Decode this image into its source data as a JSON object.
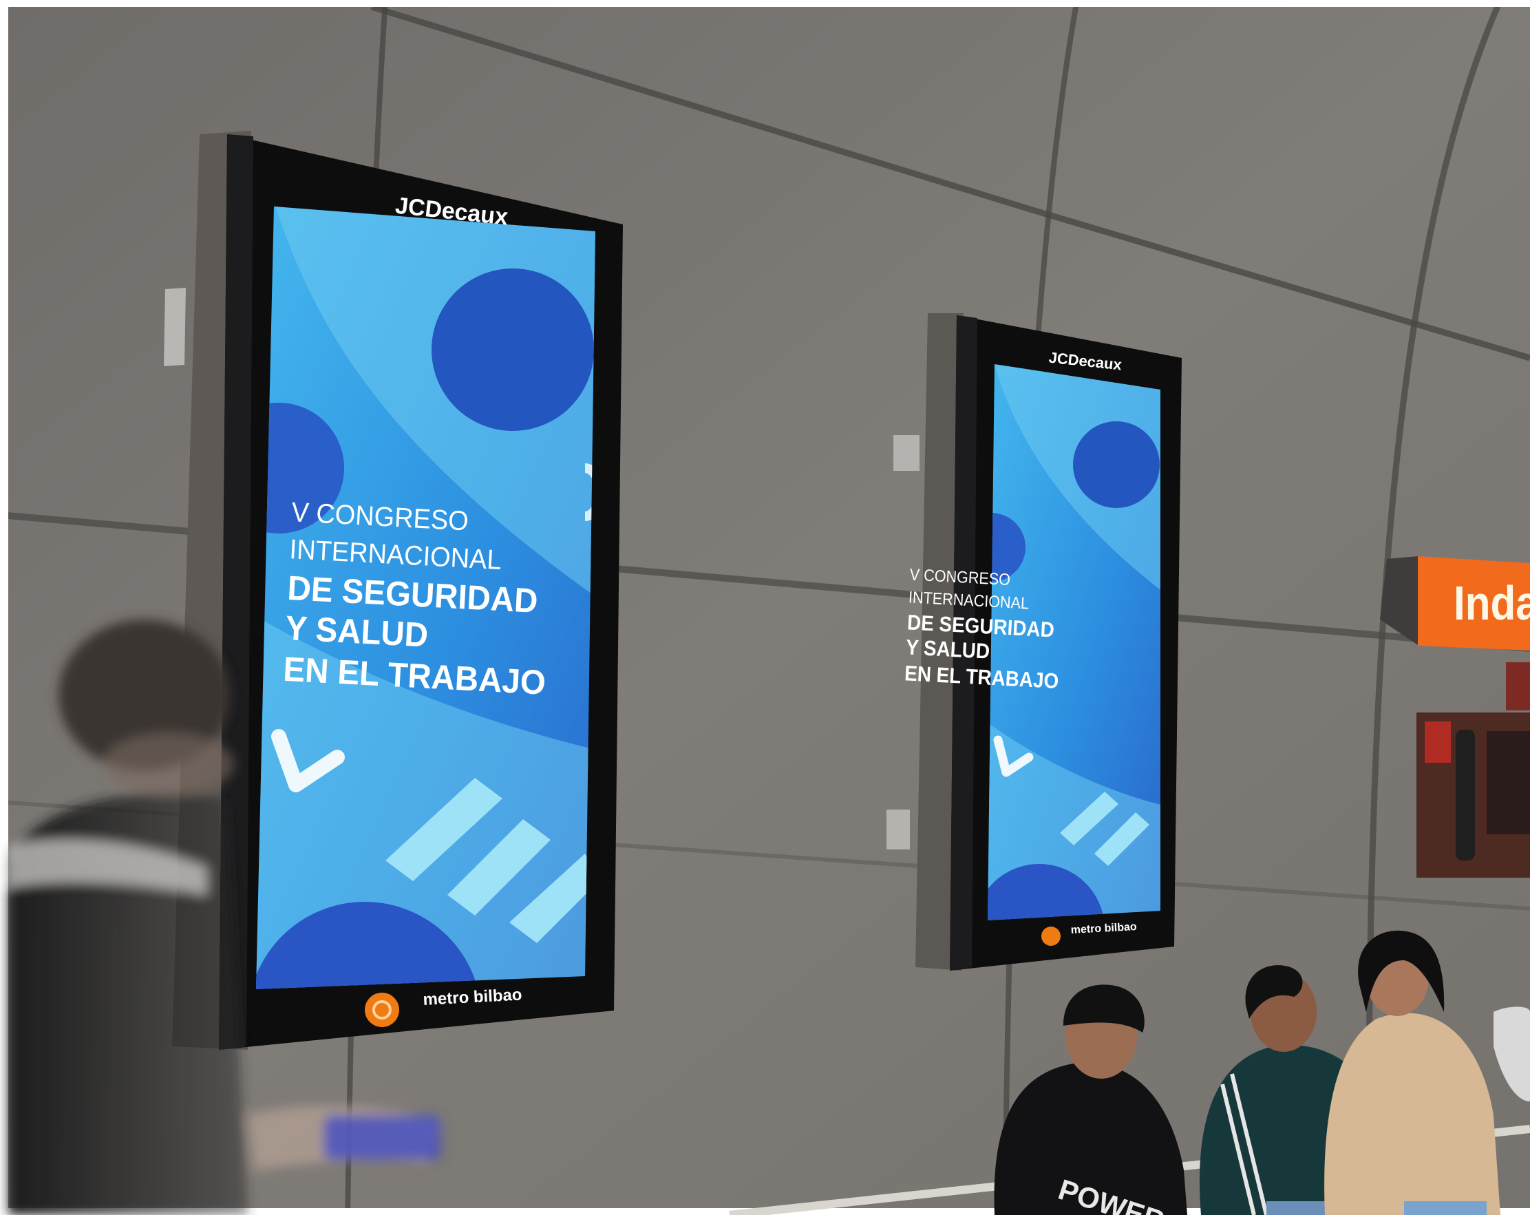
{
  "photo": {
    "description_free": true,
    "station_sign": {
      "text": "Indaut",
      "color": "#f26a1b"
    },
    "sign_boxes": [
      {
        "id": "screen-left",
        "brand": "JCDecaux",
        "headline_lines": [
          "V CONGRESO",
          "INTERNACIONAL",
          "DE SEGURIDAD",
          "Y SALUD",
          "EN EL TRABAJO"
        ],
        "footer": "metro bilbao",
        "colors": {
          "bg": "#2fa6e8",
          "deep": "#244fb8",
          "light": "#7fd4f1"
        }
      },
      {
        "id": "screen-right",
        "brand": "JCDecaux",
        "headline_lines": [
          "V CONGRESO",
          "INTERNACIONAL",
          "DE SEGURIDAD",
          "Y SALUD",
          "EN EL TRABAJO"
        ],
        "footer": "metro bilbao",
        "colors": {
          "bg": "#2fa6e8",
          "deep": "#244fb8",
          "light": "#7fd4f1"
        }
      }
    ],
    "jacket_print": "POWER",
    "colors": {
      "wall": "#7d7a76",
      "wall_dark": "#55534f",
      "wall_light": "#9a9792",
      "frame": "#111111",
      "metro_logo": "#f07b12"
    }
  }
}
